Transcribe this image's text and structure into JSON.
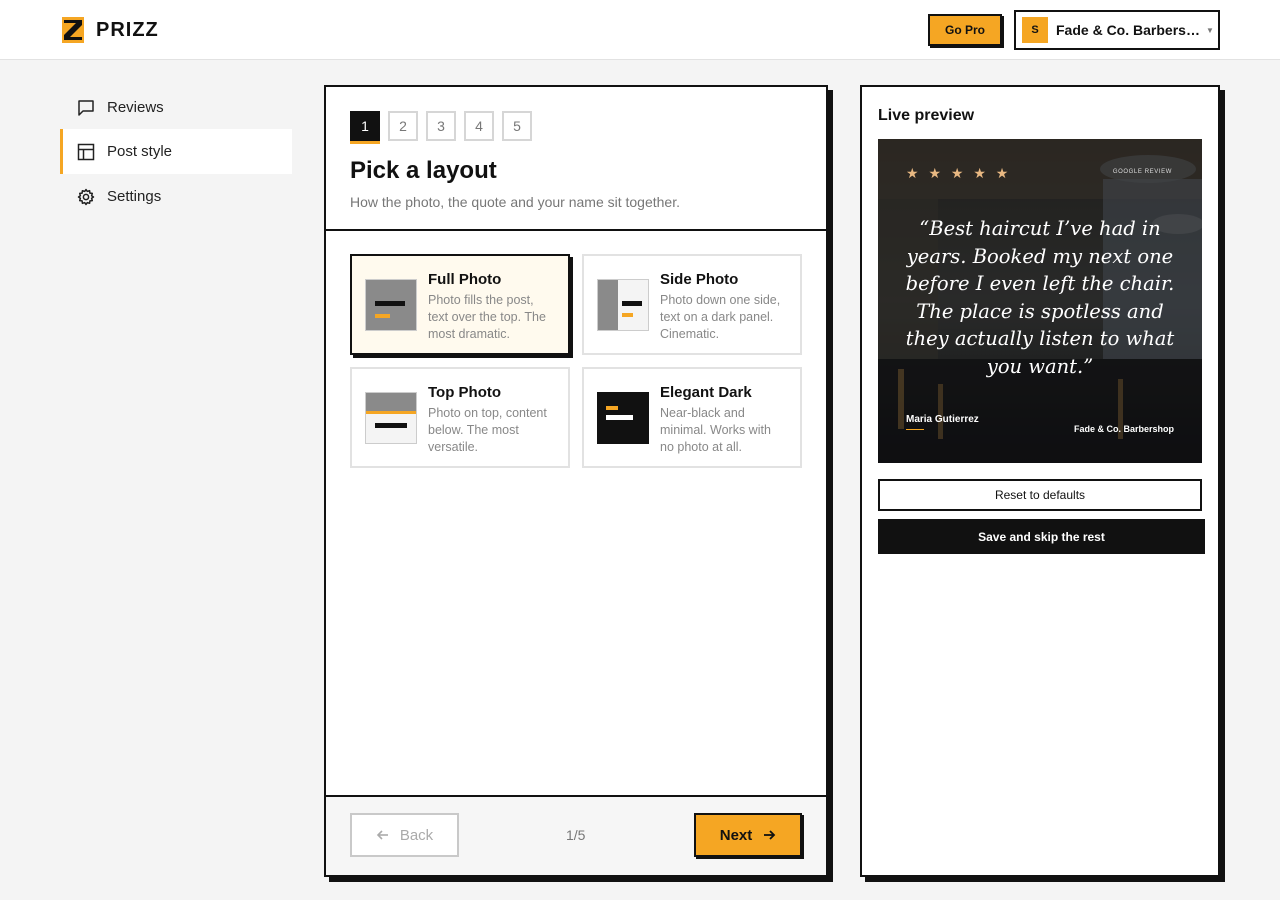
{
  "app": {
    "name": "PRIZZ",
    "accent": "#f5a623"
  },
  "header": {
    "go_pro": "Go Pro",
    "business": {
      "initial": "S",
      "name": "Fade & Co. Barbersh..."
    }
  },
  "sidebar": {
    "items": [
      {
        "label": "Reviews",
        "icon": "chat-bubble-icon"
      },
      {
        "label": "Post style",
        "icon": "layout-icon",
        "active": true
      },
      {
        "label": "Settings",
        "icon": "gear-icon"
      }
    ]
  },
  "wizard": {
    "steps": [
      "1",
      "2",
      "3",
      "4",
      "5"
    ],
    "current_step": 1,
    "title": "Pick a layout",
    "subtitle": "How the photo, the quote and your name sit together.",
    "layouts": [
      {
        "title": "Full Photo",
        "desc": "Photo fills the post, text over the top. The most dramatic.",
        "selected": true
      },
      {
        "title": "Side Photo",
        "desc": "Photo down one side, text on a dark panel. Cinematic."
      },
      {
        "title": "Top Photo",
        "desc": "Photo on top, content below. The most versatile."
      },
      {
        "title": "Elegant Dark",
        "desc": "Near-black and minimal. Works with no photo at all."
      }
    ],
    "footer": {
      "back": "Back",
      "page": "1/5",
      "next": "Next"
    }
  },
  "preview": {
    "title": "Live preview",
    "stars": "★ ★ ★ ★ ★",
    "tag": "GOOGLE REVIEW",
    "quote": "“Best haircut I’ve had in years. Booked my next one before I even left the chair. The place is spotless and they actually listen to what you want.”",
    "author": "Maria Gutierrez",
    "business": "Fade & Co. Barbershop",
    "reset": "Reset to defaults",
    "save": "Save and skip the rest"
  }
}
